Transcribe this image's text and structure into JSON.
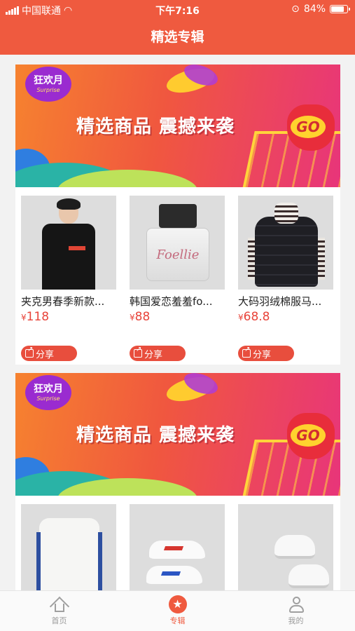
{
  "status_bar": {
    "carrier": "中国联通",
    "time": "下午7:16",
    "battery_text": "84%",
    "battery_level": 0.84
  },
  "nav": {
    "title": "精选专辑"
  },
  "albums": [
    {
      "banner": {
        "logo_text": "狂欢月",
        "logo_sub": "Surprise",
        "headline": "精选商品 震撼来袭",
        "go_label": "GO"
      },
      "products": [
        {
          "name": "夹克男春季新款...",
          "currency": "¥",
          "price": "118",
          "share_label": "分享",
          "image": "black-jacket"
        },
        {
          "name": "韩国爱恋羞羞fo...",
          "currency": "¥",
          "price": "88",
          "share_label": "分享",
          "image": "perfume-bottle",
          "image_text": "Foellie"
        },
        {
          "name": "大码羽绒棉服马...",
          "currency": "¥",
          "price": "68.8",
          "share_label": "分享",
          "image": "puffer-jacket"
        }
      ]
    },
    {
      "banner": {
        "logo_text": "狂欢月",
        "logo_sub": "Surprise",
        "headline": "精选商品 震撼来袭",
        "go_label": "GO"
      },
      "products": [
        {
          "image": "white-sweater"
        },
        {
          "image": "white-sneakers"
        },
        {
          "image": "white-shoes"
        }
      ]
    }
  ],
  "tabbar": {
    "items": [
      {
        "label": "首页",
        "icon": "home-icon",
        "active": false
      },
      {
        "label": "专辑",
        "icon": "star-icon",
        "active": true
      },
      {
        "label": "我的",
        "icon": "user-icon",
        "active": false
      }
    ]
  },
  "colors": {
    "brand": "#ef5a3f",
    "price": "#e8443a",
    "tab_inactive": "#9a9a9a"
  }
}
